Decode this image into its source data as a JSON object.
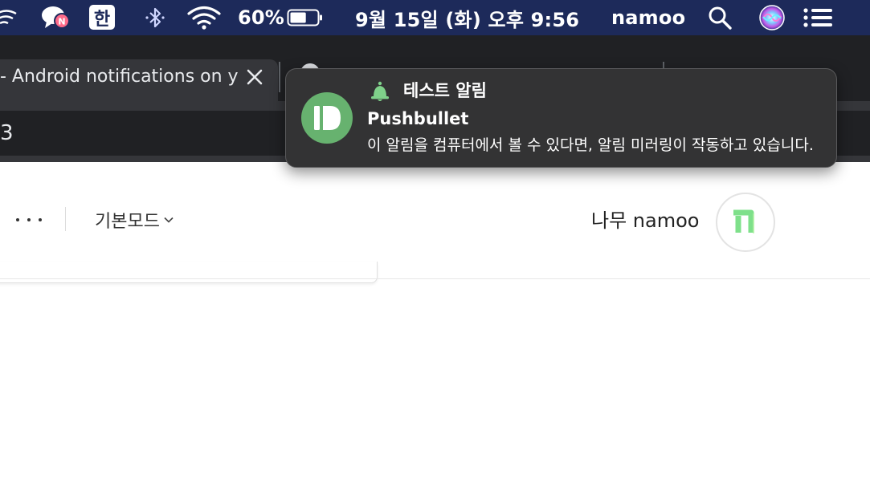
{
  "menubar": {
    "battery_percent": "60%",
    "battery_level": 0.6,
    "ime_char": "한",
    "datetime": "9월 15일 (화) 오후  9:56",
    "username": "namoo",
    "icons": [
      "wifi-partial-icon",
      "messenger-icon",
      "ime-indicator",
      "bluetooth-icon",
      "wifi-icon",
      "battery-icon",
      "spotlight-icon",
      "siri-icon",
      "control-center-icon"
    ]
  },
  "browser": {
    "tab_title": "- Android notifications on y",
    "omnibox_text": "3"
  },
  "notification": {
    "title": "테스트 알림",
    "app_name": "Pushbullet",
    "body": "이 알림을 컴퓨터에서 볼 수 있다면, 알림 미러링이 작동하고 있습니다.",
    "accent": "#67b26f"
  },
  "page": {
    "mode_label": "기본모드",
    "user_name": "나무 namoo"
  },
  "colors": {
    "menubar_bg": "#1d2a5a",
    "browser_bg": "#202124",
    "notification_bg": "#333334",
    "pushbullet_green": "#67b26f"
  }
}
